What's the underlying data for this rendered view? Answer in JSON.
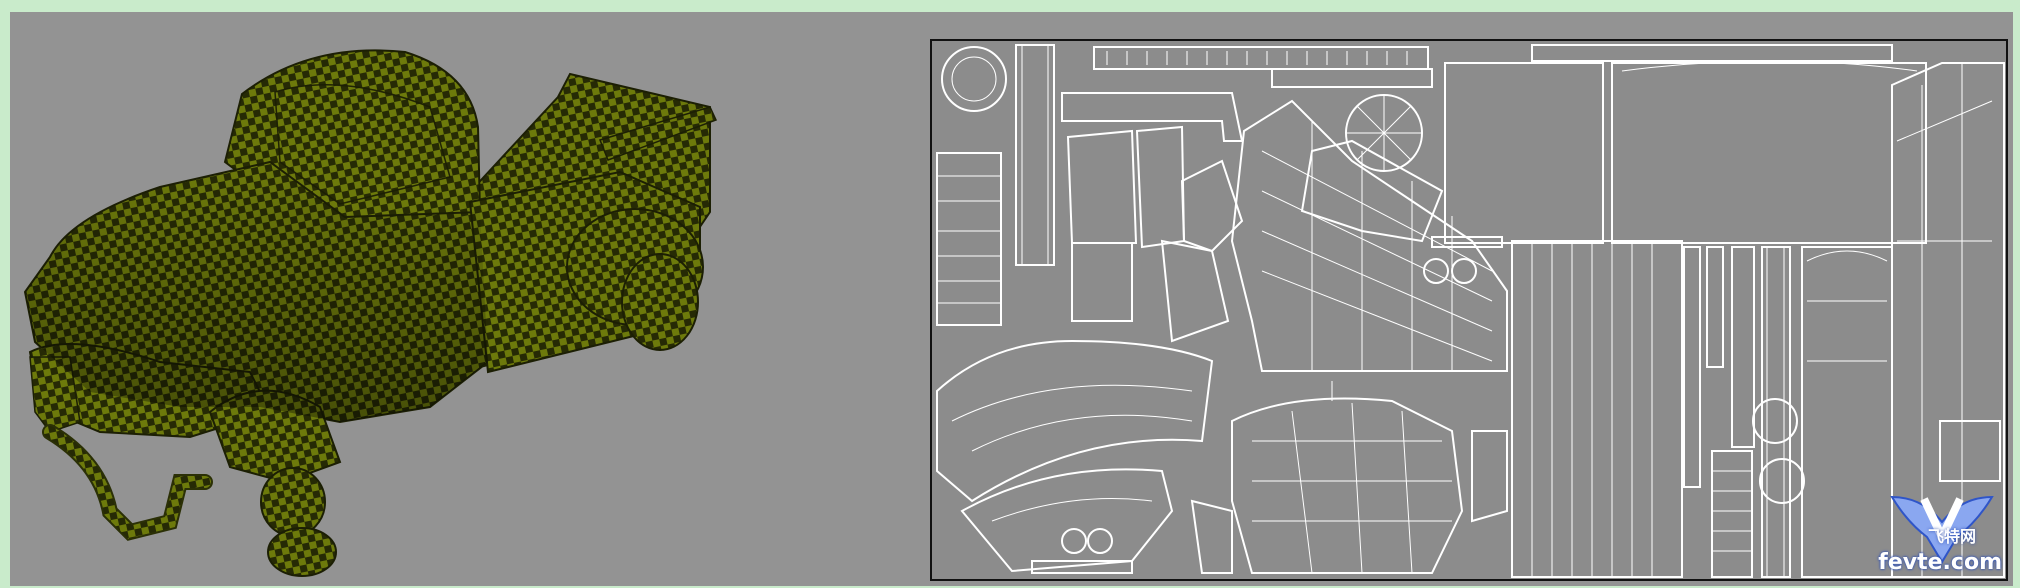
{
  "viewport": {
    "left_view": "perspective-truck-checker",
    "right_view": "uv-layout"
  },
  "colors": {
    "frame": "#c9ebcb",
    "viewport_bg": "#939393",
    "checker_a": "#6d7a0b",
    "checker_b": "#262a05",
    "uv_bg": "#8c8c8c",
    "uv_line": "#ffffff"
  },
  "watermark": {
    "logo_letter": "V",
    "site_cn": "飞特网",
    "site": "fevte.com"
  }
}
